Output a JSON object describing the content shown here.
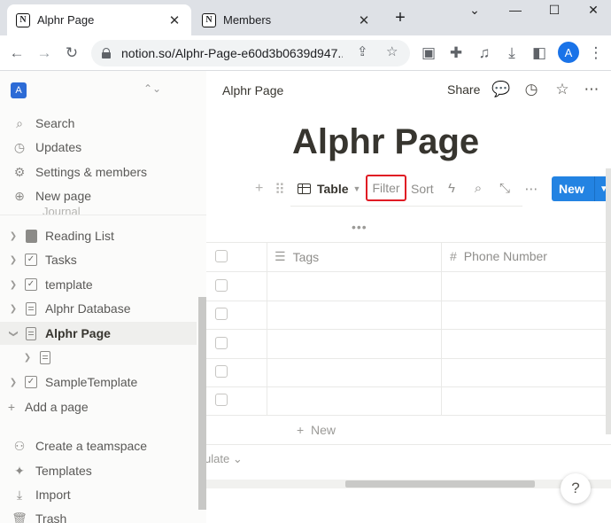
{
  "browser": {
    "tabs": [
      {
        "title": "Alphr Page",
        "active": true
      },
      {
        "title": "Members",
        "active": false
      }
    ],
    "url": "notion.so/Alphr-Page-e60d3b0639d947...",
    "profile_initial": "A"
  },
  "sidebar": {
    "workspace_initial": "A",
    "top_items": [
      {
        "label": "Search",
        "icon": "search-icon"
      },
      {
        "label": "Updates",
        "icon": "clock-icon"
      },
      {
        "label": "Settings & members",
        "icon": "gear-icon"
      },
      {
        "label": "New page",
        "icon": "plus-circle-icon"
      }
    ],
    "faded_label": "Journal",
    "pages": [
      {
        "label": "Reading List",
        "icon": "book-icon",
        "selected": false
      },
      {
        "label": "Tasks",
        "icon": "checkbox-icon",
        "selected": false
      },
      {
        "label": "template",
        "icon": "checkbox-icon",
        "selected": false
      },
      {
        "label": "Alphr Database",
        "icon": "document-icon",
        "selected": false
      },
      {
        "label": "Alphr Page",
        "icon": "document-icon",
        "selected": true
      },
      {
        "label": "",
        "icon": "document-icon",
        "selected": false
      },
      {
        "label": "SampleTemplate",
        "icon": "checkbox-icon",
        "selected": false
      }
    ],
    "add_page": "Add a page",
    "bottom_items": [
      {
        "label": "Create a teamspace",
        "icon": "teamspace-icon"
      },
      {
        "label": "Templates",
        "icon": "templates-icon"
      },
      {
        "label": "Import",
        "icon": "import-icon"
      },
      {
        "label": "Trash",
        "icon": "trash-icon"
      }
    ]
  },
  "topbar": {
    "breadcrumb": "Alphr Page",
    "share": "Share"
  },
  "page": {
    "title": "Alphr Page"
  },
  "database": {
    "view_label": "Table",
    "filter_label": "Filter",
    "sort_label": "Sort",
    "new_label": "New",
    "columns": [
      {
        "label": "Tags",
        "icon": "list-icon"
      },
      {
        "label": "Phone Number",
        "icon": "hash-icon"
      }
    ],
    "row_count": 5,
    "add_row_label": "New",
    "calculate_label": "ulate"
  },
  "help_label": "?",
  "colors": {
    "accent": "#2383e2",
    "highlight_box": "#e01b24",
    "sidebar_bg": "#fbfbfa"
  }
}
